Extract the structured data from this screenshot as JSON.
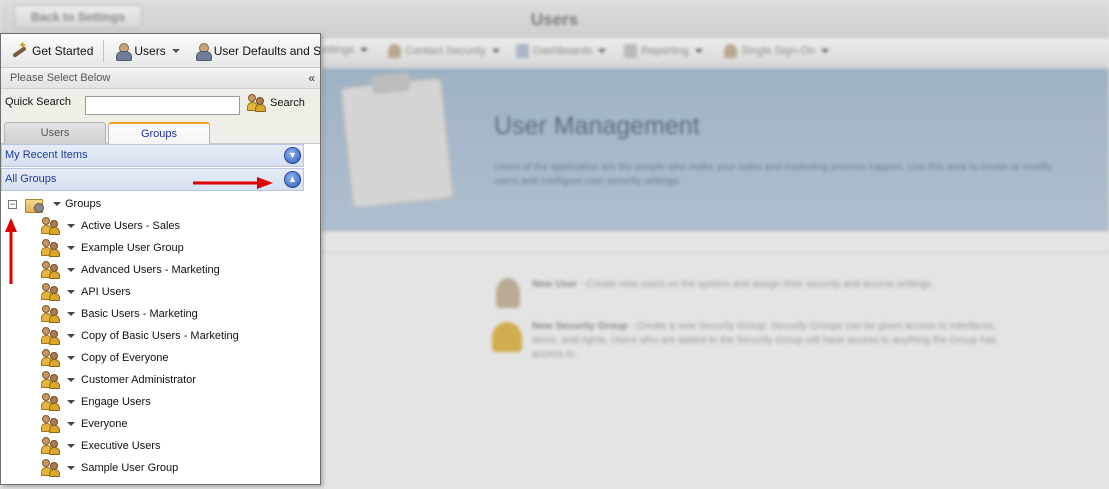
{
  "background": {
    "back_button": "Back to Settings",
    "page_title": "Users",
    "menu": [
      "Contact Security",
      "Dashboards",
      "Reporting",
      "Single Sign-On"
    ],
    "menu_partial": "ettings",
    "hero_title": "User Management",
    "hero_text": "Users of the application are the people who make your sales and marketing process happen. Use this area to create or modify users and configure user security settings.",
    "items": [
      {
        "title": "New User",
        "text": " - Create new users on the system and assign their security and access settings."
      },
      {
        "title": "New Security Group",
        "text": " - Create a new Security Group. Security Groups can be given access to interfaces, items, and rights. Users who are added to the Security Group will have access to anything the Group has access to."
      }
    ]
  },
  "toolbar": {
    "get_started": "Get Started",
    "users": "Users",
    "user_defaults": "User Defaults and Settings"
  },
  "panel": {
    "subheader": "Please Select Below",
    "collapse": "«",
    "quick_search_label": "Quick Search",
    "search_value": "",
    "search_button": "Search",
    "tabs": {
      "users": "Users",
      "groups": "Groups"
    },
    "accordion": {
      "recent": "My Recent Items",
      "all_groups": "All Groups"
    },
    "tree_root": "Groups",
    "groups": [
      "Active Users - Sales",
      "Example User Group",
      "Advanced Users - Marketing",
      "API Users",
      "Basic Users - Marketing",
      "Copy of Basic Users - Marketing",
      "Copy of Everyone",
      "Customer Administrator",
      "Engage Users",
      "Everyone",
      "Executive Users",
      "Sample User Group"
    ]
  },
  "colors": {
    "accent_blue": "#2c5fc1",
    "tab_highlight": "#f0a020",
    "annotation_red": "#e00000"
  }
}
